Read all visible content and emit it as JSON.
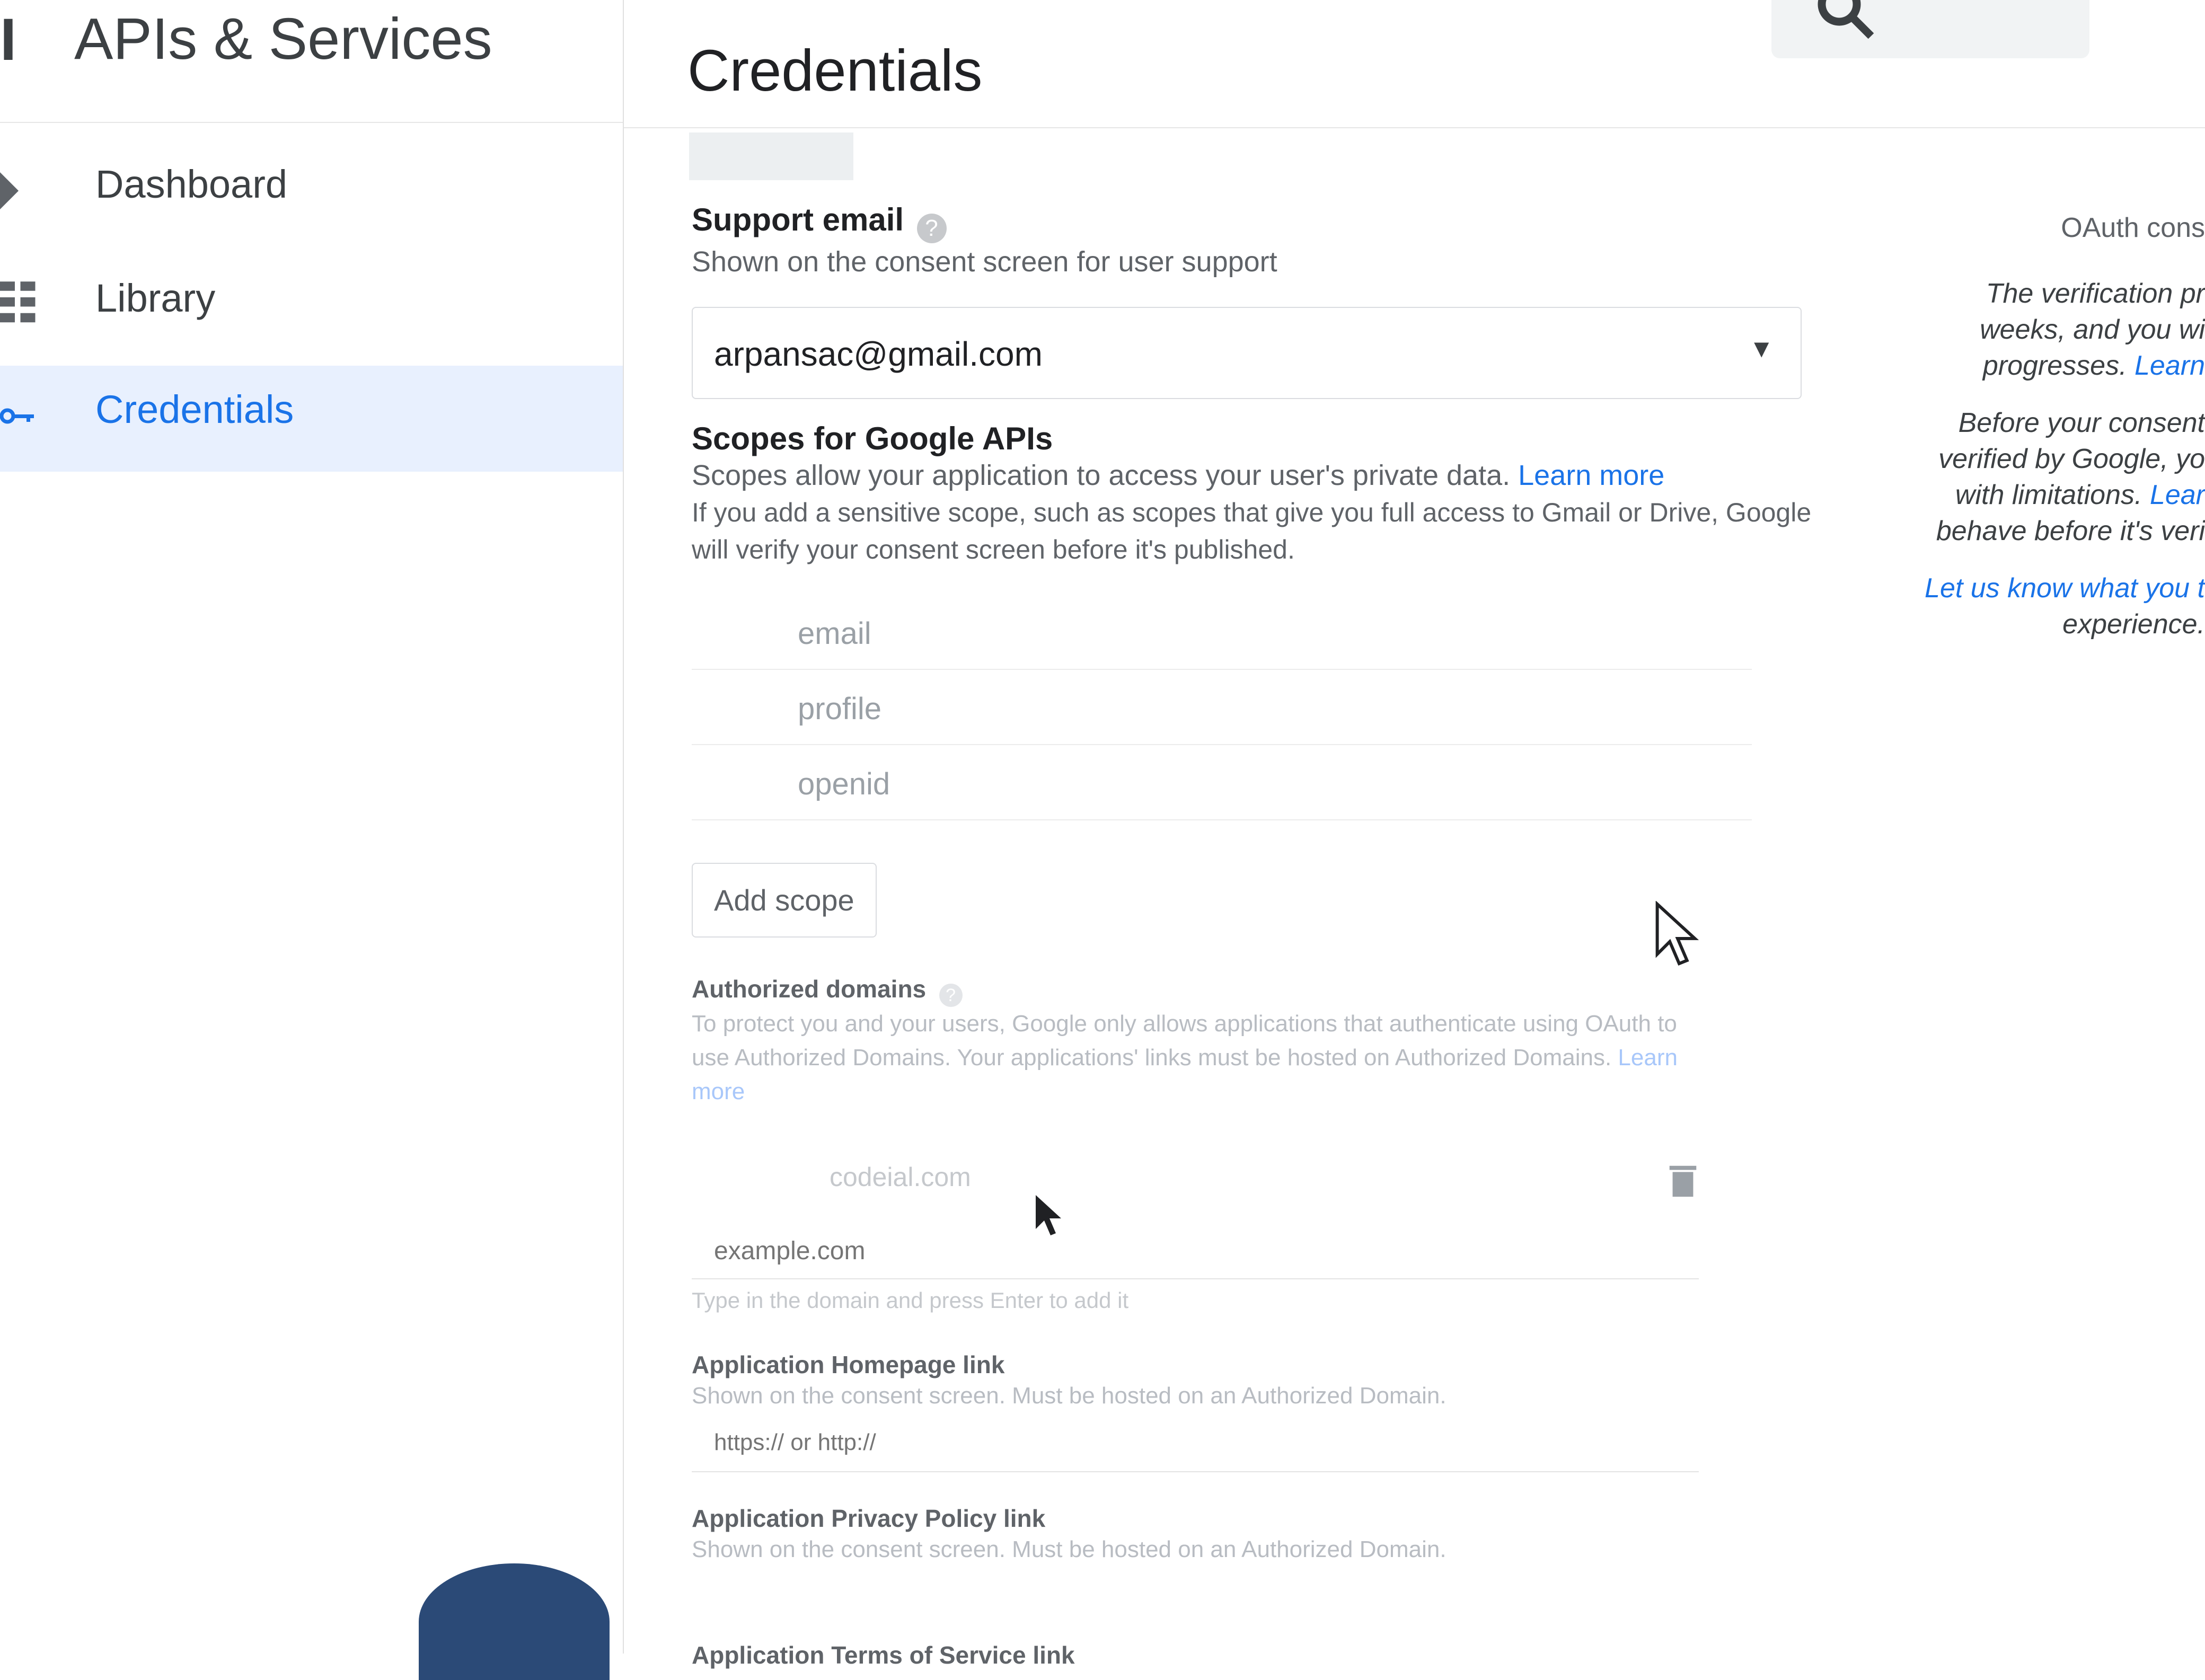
{
  "app": {
    "title": "APIs & Services",
    "menu_icon": "hamburger-icon"
  },
  "sidebar": {
    "items": [
      {
        "label": "Dashboard",
        "icon": "dashboard-icon",
        "active": false
      },
      {
        "label": "Library",
        "icon": "library-icon",
        "active": false
      },
      {
        "label": "Credentials",
        "icon": "key-icon",
        "active": true
      }
    ]
  },
  "header": {
    "title": "Credentials",
    "search_icon": "search-icon"
  },
  "support_email": {
    "label": "Support email",
    "help": "?",
    "description": "Shown on the consent screen for user support",
    "value": "arpansac@gmail.com"
  },
  "scopes": {
    "label": "Scopes for Google APIs",
    "description": "Scopes allow your application to access your user's private data.",
    "learn_more": "Learn more",
    "note": "If you add a sensitive scope, such as scopes that give you full access to Gmail or Drive, Google will verify your consent screen before it's published.",
    "items": [
      "email",
      "profile",
      "openid"
    ],
    "add_button": "Add scope"
  },
  "authorized_domains": {
    "label": "Authorized domains",
    "description": "To protect you and your users, Google only allows applications that authenticate using OAuth to use Authorized Domains. Your applications' links must be hosted on Authorized Domains.",
    "learn_more": "Learn more",
    "domain": "codeial.com",
    "placeholder": "example.com",
    "hint": "Type in the domain and press Enter to add it"
  },
  "homepage_link": {
    "label": "Application Homepage link",
    "description": "Shown on the consent screen. Must be hosted on an Authorized Domain.",
    "placeholder": "https:// or http://"
  },
  "privacy_link": {
    "label": "Application Privacy Policy link",
    "description": "Shown on the consent screen. Must be hosted on an Authorized Domain."
  },
  "terms_link": {
    "label": "Application Terms of Service link"
  },
  "right_panel": {
    "title": "OAuth cons",
    "p1": [
      "The verification pr",
      "weeks, and you wi",
      "progresses."
    ],
    "p1_link": "Learn",
    "p2": [
      "Before your consent",
      "verified by Google, yo",
      "with limitations."
    ],
    "p2_link": "Lear",
    "p2_tail": "behave before it's veri",
    "p3_link": "Let us know what you t",
    "p3_tail": "experience."
  }
}
